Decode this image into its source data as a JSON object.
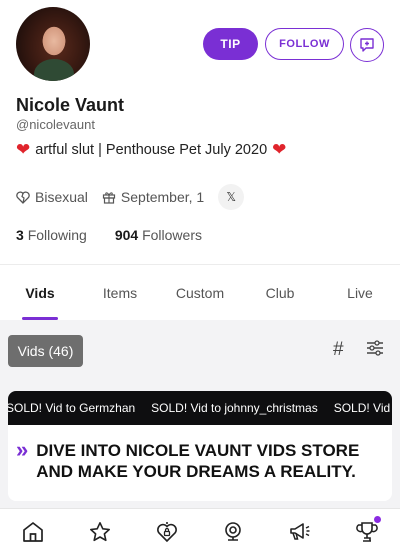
{
  "profile": {
    "name": "Nicole Vaunt",
    "handle": "@nicolevaunt",
    "bio": "artful slut | Penthouse Pet July 2020",
    "bio_emoji": "❤",
    "orientation": "Bisexual",
    "birthday": "September, 1",
    "social": "𝕏",
    "following_count": "3",
    "following_label": "Following",
    "followers_count": "904",
    "followers_label": "Followers"
  },
  "actions": {
    "tip_label": "TIP",
    "follow_label": "FOLLOW"
  },
  "tabs": [
    "Vids",
    "Items",
    "Custom",
    "Club",
    "Live"
  ],
  "active_tab": "Vids",
  "vids": {
    "count_label": "Vids (46)",
    "hash_icon": "#"
  },
  "promo": {
    "ticker": [
      "SOLD! Vid to Germzhan",
      "SOLD! Vid to johnny_christmas",
      "SOLD! Vid to n"
    ],
    "chevron": "»",
    "headline": "DIVE INTO NICOLE VAUNT VIDS STORE AND MAKE YOUR DREAMS A REALITY."
  },
  "colors": {
    "accent": "#7a2fd4",
    "heart": "#e0242c"
  }
}
